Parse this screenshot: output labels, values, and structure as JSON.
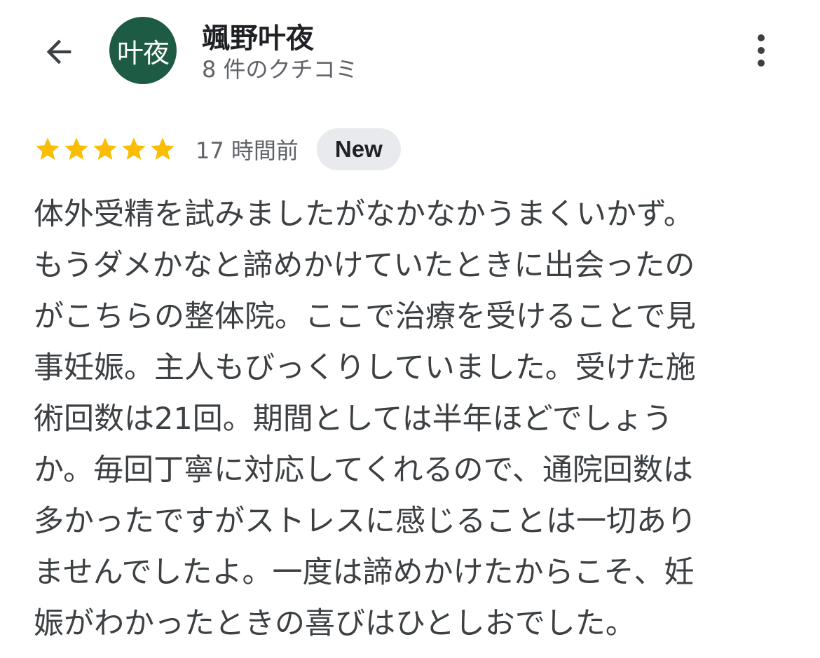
{
  "header": {
    "back_icon": "arrow-left-icon",
    "avatar_text": "叶夜",
    "avatar_color": "#1e5b45",
    "reviewer_name": "颯野叶夜",
    "review_count": "8 件のクチコミ",
    "more_icon": "more-vert-icon"
  },
  "review": {
    "rating": 5,
    "max_rating": 5,
    "star_color": "#fbbc04",
    "time_ago": "17 時間前",
    "badge": "New",
    "text_lines": [
      "体外受精を試みましたがなかなかうまくいかず。",
      "もうダメかなと諦めかけていたときに出会ったの",
      "がこちらの整体院。ここで治療を受けることで見",
      "事妊娠。主人もびっくりしていました。受けた施",
      "術回数は21回。期間としては半年ほどでしょう",
      "か。毎回丁寧に対応してくれるので、通院回数は",
      "多かったですがストレスに感じることは一切あり",
      "ませんでしたよ。一度は諦めかけたからこそ、妊",
      "娠がわかったときの喜びはひとしおでした。"
    ]
  }
}
